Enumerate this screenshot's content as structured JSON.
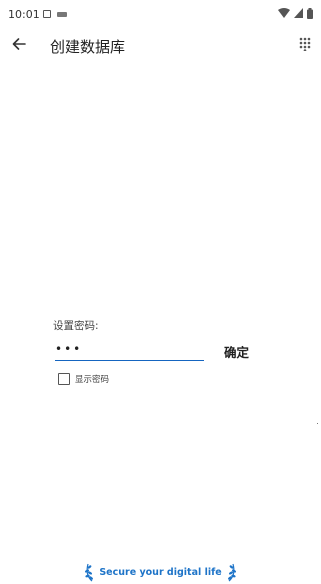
{
  "status_bar": {
    "time": "10:01",
    "icons": [
      "notification-a-icon",
      "keyboard-icon",
      "wifi-icon",
      "cell-signal-icon",
      "battery-icon"
    ]
  },
  "app_bar": {
    "title": "创建数据库",
    "back_icon": "arrow-left-icon",
    "menu_icon": "dots-grid-icon"
  },
  "form": {
    "label": "设置密码:",
    "password_value": "•••",
    "confirm_label": "确定",
    "show_password_label": "显示密码",
    "show_password_checked": false,
    "accent_color": "#1565c0"
  },
  "footer": {
    "text": "Secure your digital life",
    "color": "#1e74c8"
  }
}
